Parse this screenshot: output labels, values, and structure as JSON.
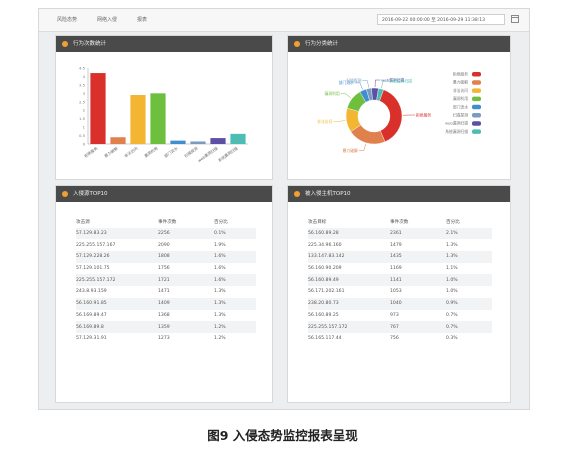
{
  "nav": {
    "tabs": [
      "风险态势",
      "网络入侵",
      "报表"
    ]
  },
  "date_range": "2016-09-22 00:00:00 至 2016-09-29 11:38:13",
  "panels": {
    "bar_title": "行为次数统计",
    "pie_title": "行为分类统计",
    "table1_title": "入侵源TOP10",
    "table2_title": "被入侵主机TOP10"
  },
  "chart_data": [
    {
      "type": "bar",
      "title": "行为次数统计",
      "categories": [
        "拒绝服务",
        "暴力破解",
        "非法访问",
        "漏洞利用",
        "部门流水",
        "扫描探测",
        "web漏洞扫描",
        "系统漏洞扫描"
      ],
      "values": [
        4.2,
        0.4,
        2.9,
        3.0,
        0.2,
        0.15,
        0.35,
        0.6
      ],
      "ylim": [
        0,
        4.5
      ],
      "yticks": [
        "4.5",
        "4",
        "3.5",
        "3",
        "2.5",
        "2",
        "1.5",
        "1",
        "0.5",
        "0"
      ],
      "colors": [
        "#d9302c",
        "#e0804c",
        "#f2b633",
        "#6fbf3f",
        "#3e8ed0",
        "#7a9bbd",
        "#5c4fa6",
        "#4dbdb3"
      ]
    },
    {
      "type": "pie",
      "title": "行为分类统计",
      "labels": [
        "拒绝服务",
        "暴力破解",
        "非法访问",
        "漏洞利用",
        "部门流水",
        "扫描探测",
        "web漏洞扫描",
        "系统漏洞扫描"
      ],
      "values": [
        38,
        22,
        14,
        12,
        4,
        3,
        4,
        3
      ],
      "colors": [
        "#d9302c",
        "#e0804c",
        "#f2b633",
        "#6fbf3f",
        "#3e8ed0",
        "#7a9bbd",
        "#5c4fa6",
        "#4dbdb3"
      ],
      "legend": "right"
    }
  ],
  "table1": {
    "headers": [
      "攻击源",
      "事件次数",
      "百分比"
    ],
    "rows": [
      [
        "57.129.83.23",
        "2256",
        "0.1%"
      ],
      [
        "225.255.157.167",
        "2090",
        "1.9%"
      ],
      [
        "57.129.228.26",
        "1808",
        "1.6%"
      ],
      [
        "57.129.101.75",
        "1756",
        "1.6%"
      ],
      [
        "225.255.157.172",
        "1721",
        "1.6%"
      ],
      [
        "243.8.93.159",
        "1471",
        "1.3%"
      ],
      [
        "56.160.91.85",
        "1409",
        "1.3%"
      ],
      [
        "56.169.89.47",
        "1368",
        "1.3%"
      ],
      [
        "56.169.89.8",
        "1359",
        "1.2%"
      ],
      [
        "57.129.31.91",
        "1273",
        "1.2%"
      ]
    ]
  },
  "table2": {
    "headers": [
      "攻击目标",
      "事件次数",
      "百分比"
    ],
    "rows": [
      [
        "56.160.89.28",
        "2361",
        "2.1%"
      ],
      [
        "225.34.96.160",
        "1479",
        "1.3%"
      ],
      [
        "133.147.83.142",
        "1435",
        "1.3%"
      ],
      [
        "56.160.90.209",
        "1169",
        "1.1%"
      ],
      [
        "56.160.89.49",
        "1141",
        "1.0%"
      ],
      [
        "56.171.202.161",
        "1053",
        "1.0%"
      ],
      [
        "238.20.80.73",
        "1040",
        "0.9%"
      ],
      [
        "56.160.89.25",
        "973",
        "0.7%"
      ],
      [
        "225.255.157.172",
        "767",
        "0.7%"
      ],
      [
        "56.165.117.44",
        "756",
        "0.3%"
      ]
    ]
  },
  "caption": "图9  入侵态势监控报表呈现"
}
